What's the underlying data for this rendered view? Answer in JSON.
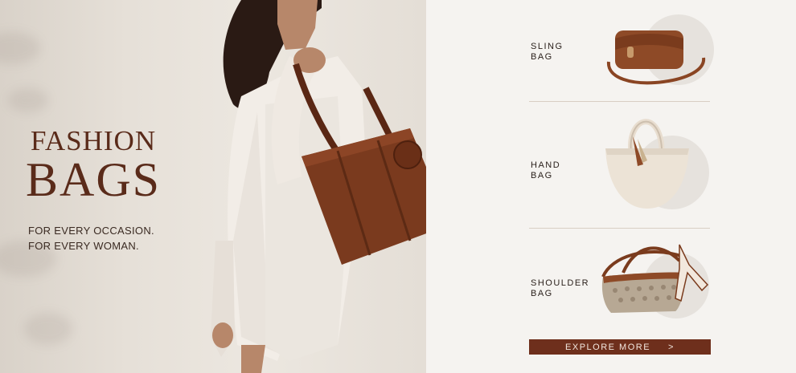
{
  "hero": {
    "title_line1": "FASHION",
    "title_line2": "BAGS",
    "tagline_line1": "FOR EVERY OCCASION.",
    "tagline_line2": "FOR EVERY WOMAN."
  },
  "products": [
    {
      "label_line1": "SLING",
      "label_line2": "BAG",
      "icon": "sling-bag-icon"
    },
    {
      "label_line1": "HAND",
      "label_line2": "BAG",
      "icon": "hand-bag-icon"
    },
    {
      "label_line1": "SHOULDER",
      "label_line2": "BAG",
      "icon": "shoulder-bag-icon"
    }
  ],
  "cta": {
    "label": "EXPLORE MORE",
    "chevron": ">"
  },
  "colors": {
    "brand_brown": "#6e2f1c",
    "title_brown": "#5a2b1a",
    "panel_bg": "#f5f3f0"
  }
}
